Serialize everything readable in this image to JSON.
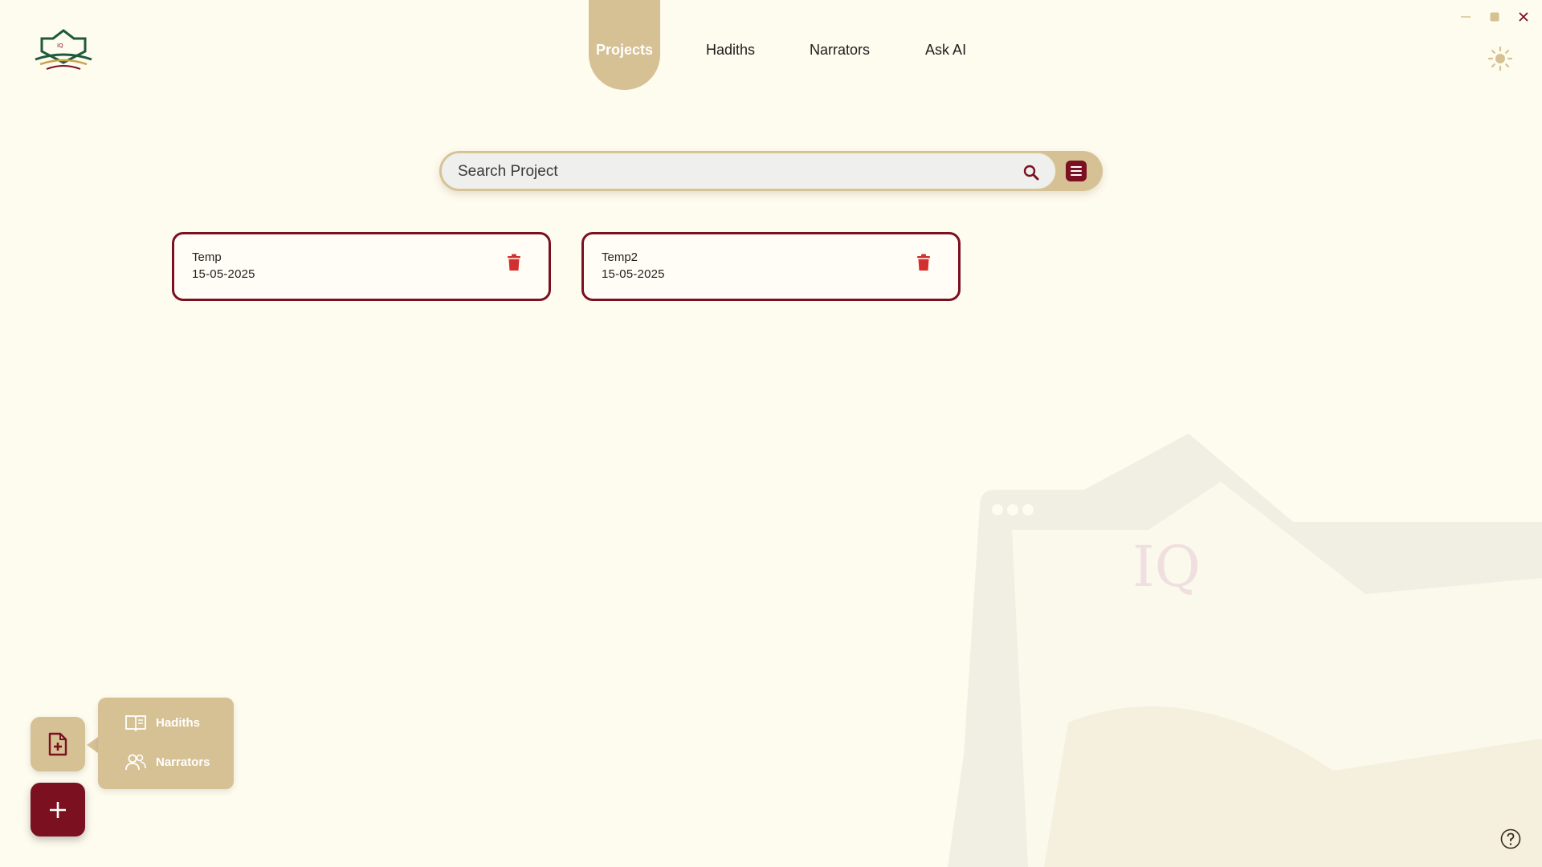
{
  "nav": {
    "items": [
      {
        "label": "Projects",
        "active": true
      },
      {
        "label": "Hadiths",
        "active": false
      },
      {
        "label": "Narrators",
        "active": false
      },
      {
        "label": "Ask AI",
        "active": false
      }
    ]
  },
  "search": {
    "placeholder": "Search Project",
    "value": ""
  },
  "projects": [
    {
      "name": "Temp",
      "date": "15-05-2025"
    },
    {
      "name": "Temp2",
      "date": "15-05-2025"
    }
  ],
  "fab_menu": {
    "items": [
      {
        "label": "Hadiths",
        "icon": "book-icon"
      },
      {
        "label": "Narrators",
        "icon": "users-icon"
      }
    ]
  },
  "colors": {
    "background": "#fefbef",
    "accent_tan": "#d6c194",
    "primary_maroon": "#7a1020",
    "delete_red": "#d32f2f"
  },
  "icons": {
    "window": [
      "minimize-icon",
      "maximize-icon",
      "close-icon"
    ],
    "theme": "sun-icon",
    "search": "search-icon",
    "filter": "list-filter-icon",
    "delete": "trash-icon",
    "new_document": "document-plus-icon",
    "add": "plus-icon",
    "help": "question-circle-icon"
  }
}
